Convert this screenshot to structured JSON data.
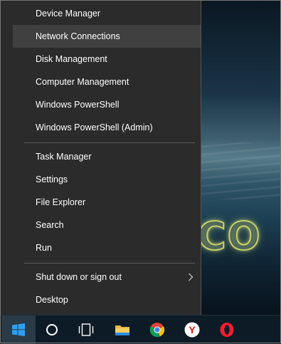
{
  "menu": {
    "group1": [
      {
        "label": "Device Manager"
      },
      {
        "label": "Network Connections"
      },
      {
        "label": "Disk Management"
      },
      {
        "label": "Computer Management"
      },
      {
        "label": "Windows PowerShell"
      },
      {
        "label": "Windows PowerShell (Admin)"
      }
    ],
    "group2": [
      {
        "label": "Task Manager"
      },
      {
        "label": "Settings"
      },
      {
        "label": "File Explorer"
      },
      {
        "label": "Search"
      },
      {
        "label": "Run"
      }
    ],
    "group3": [
      {
        "label": "Shut down or sign out"
      },
      {
        "label": "Desktop"
      }
    ],
    "highlighted_item": "Network Connections"
  },
  "taskbar": {
    "items": [
      {
        "icon": "windows-start-icon",
        "state": "active"
      },
      {
        "icon": "cortana-search-icon"
      },
      {
        "icon": "task-view-icon"
      },
      {
        "icon": "file-explorer-icon"
      },
      {
        "icon": "chrome-icon"
      },
      {
        "icon": "yandex-browser-icon",
        "text": "Y"
      },
      {
        "icon": "opera-icon"
      }
    ]
  },
  "wallpaper": {
    "glow_text": "CO"
  },
  "colors": {
    "menu_bg": "#2b2b2b",
    "menu_highlight": "#404040",
    "menu_text": "#ffffff",
    "taskbar_bg": "#0d1b26",
    "accent_blue": "#2e9ff0"
  }
}
